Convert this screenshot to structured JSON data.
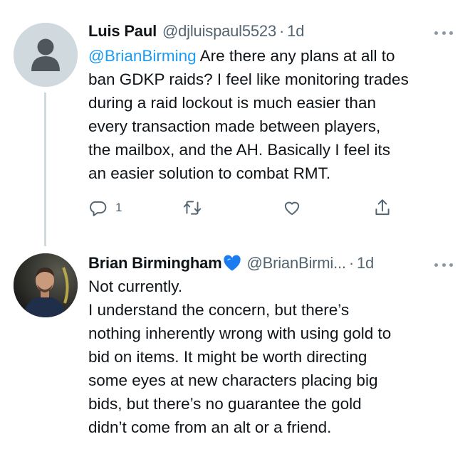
{
  "tweets": [
    {
      "author": {
        "name": "Luis Paul",
        "handle": "@djluispaul5523"
      },
      "separator": "·",
      "time": "1d",
      "mention": "@BrianBirming",
      "lines": [
        " Are there any plans at all to",
        "ban GDKP raids? I feel like monitoring trades",
        "during a raid lockout is much easier than",
        "every transaction made between players,",
        "the mailbox, and the AH. Basically I feel its",
        "an easier solution to combat RMT."
      ],
      "actions": {
        "reply_count": "1"
      }
    },
    {
      "author": {
        "name": "Brian Birmingham",
        "handle": "@BrianBirmi...",
        "verified_icon": "blue-heart-icon"
      },
      "separator": "·",
      "time": "1d",
      "lines": [
        "Not currently.",
        "I understand the concern, but there’s",
        "nothing inherently wrong with using gold to",
        "bid on items.  It might be worth directing",
        "some eyes at new characters placing big",
        "bids, but there’s no guarantee the gold",
        "didn’t come from an alt or a friend."
      ]
    }
  ],
  "icons": {
    "reply": "reply-icon",
    "retweet": "retweet-icon",
    "like": "heart-icon",
    "share": "share-icon",
    "more": "more-icon"
  },
  "colors": {
    "link": "#1d9bf0",
    "text": "#0f1419",
    "secondary": "#536471",
    "verified_heart": "#1d7bf0"
  }
}
